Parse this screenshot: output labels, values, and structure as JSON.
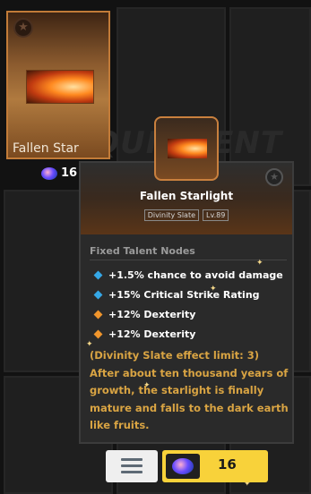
{
  "card": {
    "name": "Fallen Star",
    "price": "16"
  },
  "tooltip": {
    "title": "Fallen Starlight",
    "tags": [
      "Divinity Slate",
      "Lv.89"
    ],
    "section_title": "Fixed Talent Nodes",
    "nodes": [
      {
        "text": "+1.5% chance to avoid damage",
        "color": "#35a7e6"
      },
      {
        "text": "+15% Critical Strike Rating",
        "color": "#35a7e6"
      },
      {
        "text": "+12% Dexterity",
        "color": "#f0952c"
      },
      {
        "text": "+12% Dexterity",
        "color": "#f0952c"
      }
    ],
    "description": [
      "(Divinity Slate effect limit: 3)",
      "After about ten thousand years of",
      "growth, the starlight is finally",
      "mature and falls to the dark earth",
      "like fruits."
    ]
  },
  "footer": {
    "price": "16"
  },
  "background_text": "EQUIPMENT",
  "icons": {
    "star": "star-badge-icon",
    "gem": "gem-currency-icon",
    "menu": "menu-lines-icon"
  },
  "colors": {
    "accent_gold": "#d9a443",
    "price_yellow": "#f8d23a",
    "node_blue": "#35a7e6",
    "node_orange": "#f0952c"
  }
}
